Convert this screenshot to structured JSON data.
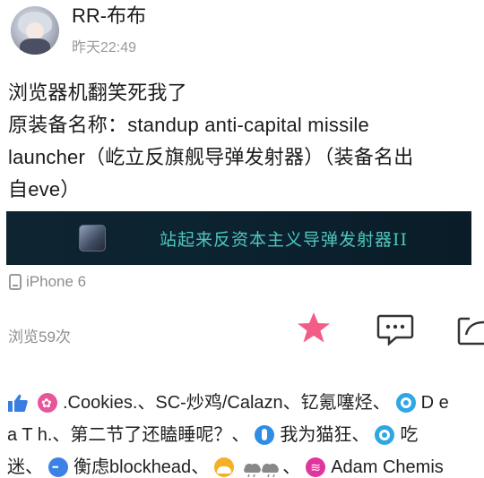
{
  "post": {
    "username": "RR-布布",
    "time": "昨天22:49",
    "text_lines": [
      "浏览器机翻笑死我了",
      "原装备名称：standup anti-capital missile",
      "launcher（屹立反旗舰导弹发射器）（装备名出",
      "自eve）"
    ],
    "banner_text": "站起来反资本主义导弹发射器II",
    "device": "iPhone 6",
    "views": "浏览59次"
  },
  "likes": {
    "line1": [
      ".Cookies.",
      "、SC-炒鸡/Calazn",
      "、钇氪噻烃",
      "、",
      "D e"
    ],
    "line2": [
      "a T h.",
      "、第二节了还瞌睡呢？",
      "、",
      "我为猫狂",
      "、",
      "吃"
    ],
    "line3": [
      "迷",
      "、",
      "衡虑blockhead",
      "、",
      "、",
      "Adam Chemis"
    ]
  },
  "colors": {
    "star": "#f25c86",
    "banner_bg": "#0c2330",
    "banner_text": "#4dc6c0",
    "thumb": "#3a7de0"
  },
  "icons": [
    "thumbs-up-icon",
    "star-icon",
    "comment-icon",
    "share-icon",
    "phone-icon"
  ]
}
